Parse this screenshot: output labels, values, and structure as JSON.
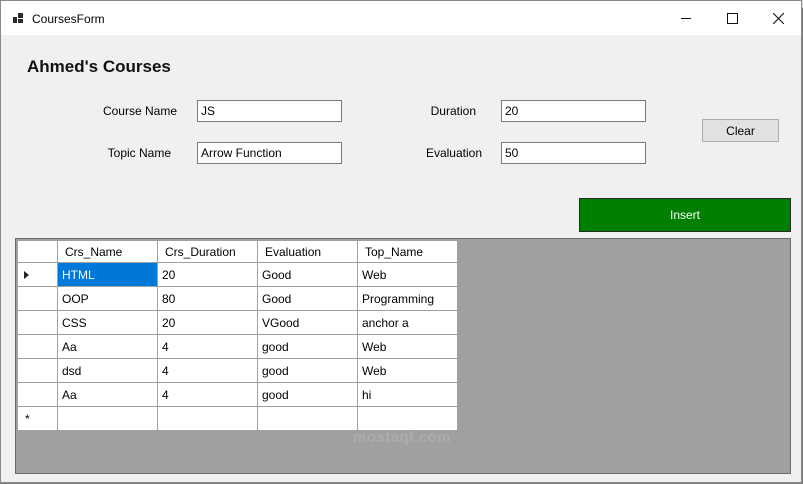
{
  "window": {
    "title": "CoursesForm"
  },
  "heading": "Ahmed's Courses",
  "form": {
    "course_name_label": "Course Name",
    "course_name_value": "JS",
    "topic_name_label": "Topic Name",
    "topic_name_value": "Arrow Function",
    "duration_label": "Duration",
    "duration_value": "20",
    "evaluation_label": "Evaluation",
    "evaluation_value": "50",
    "clear_label": "Clear",
    "insert_label": "Insert"
  },
  "colors": {
    "insert_bg": "#008000",
    "selection": "#0078d7",
    "grid_bg": "#a0a0a0"
  },
  "grid": {
    "columns": [
      "Crs_Name",
      "Crs_Duration",
      "Evaluation",
      "Top_Name"
    ],
    "rows": [
      [
        "HTML",
        "20",
        "Good",
        "Web"
      ],
      [
        "OOP",
        "80",
        "Good",
        "Programming"
      ],
      [
        "CSS",
        "20",
        "VGood",
        "anchor a"
      ],
      [
        "Aa",
        "4",
        "good",
        "Web"
      ],
      [
        "dsd",
        "4",
        "good",
        "Web"
      ],
      [
        "Aa",
        "4",
        "good",
        "hi"
      ]
    ],
    "current_row_marker": "arrow",
    "new_row_marker": "*"
  },
  "watermark": "mostaql.com"
}
